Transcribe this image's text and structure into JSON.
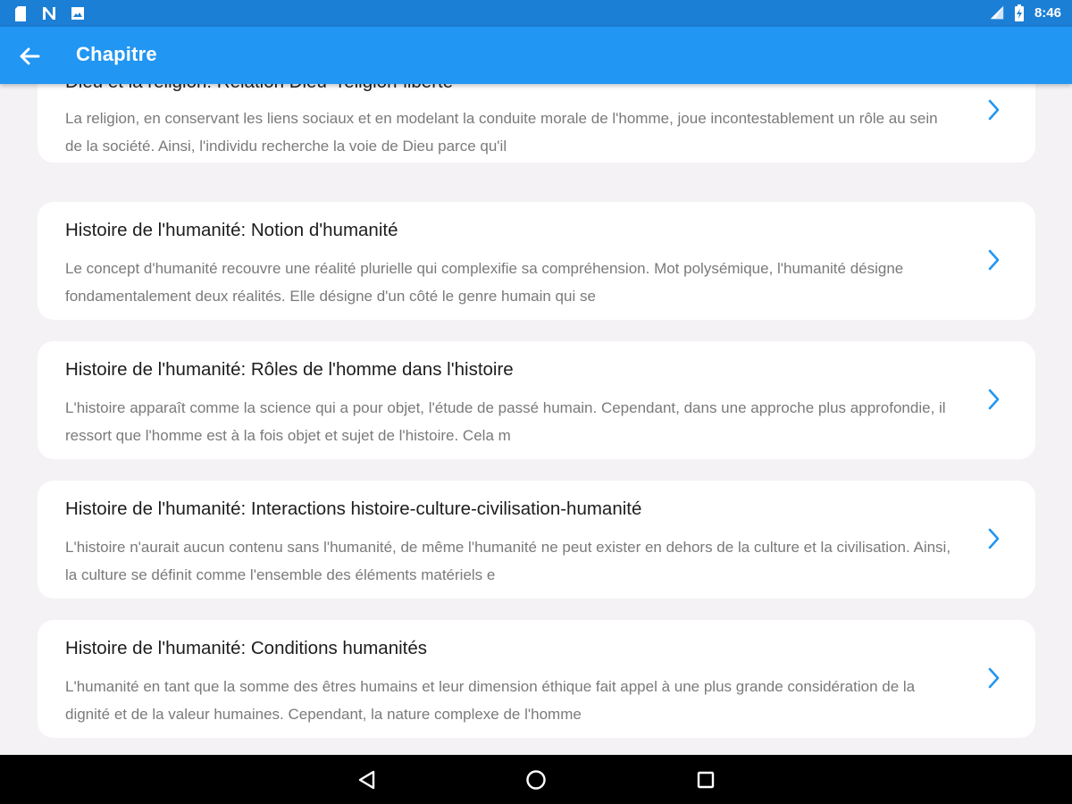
{
  "status_bar": {
    "time": "8:46",
    "left_icons": [
      "sd-card-icon",
      "n-notification-icon",
      "image-notification-icon"
    ],
    "right_icons": [
      "signal-icon",
      "battery-icon"
    ]
  },
  "app_bar": {
    "title": "Chapitre",
    "back_icon": "arrow-back-icon"
  },
  "chapters": [
    {
      "title": "Dieu et la religion: Relation Dieu- religion-liberté",
      "description": "La religion, en conservant les liens sociaux et en modelant la conduite morale de l'homme, joue incontestablement un rôle au sein de la société. Ainsi, l'individu recherche la voie de Dieu parce qu'il"
    },
    {
      "title": "Histoire de l'humanité: Notion d'humanité",
      "description": "Le concept d'humanité recouvre une réalité plurielle qui complexifie sa compréhension. Mot polysémique, l'humanité désigne fondamentalement deux réalités. Elle désigne d'un côté le genre humain qui se"
    },
    {
      "title": "Histoire de l'humanité: Rôles de l'homme dans l'histoire",
      "description": "L'histoire apparaît comme la science qui a pour objet, l'étude de passé humain. Cependant, dans une approche plus approfondie, il ressort que l'homme est à la fois objet et sujet de l'histoire. Cela m"
    },
    {
      "title": "Histoire de l'humanité: Interactions histoire-culture-civilisation-humanité",
      "description": "L'histoire n'aurait aucun contenu sans l'humanité, de même l'humanité ne peut exister en dehors de la culture et la civilisation. Ainsi, la culture se définit comme l'ensemble des éléments matériels e"
    },
    {
      "title": "Histoire de l'humanité: Conditions humanités",
      "description": "L'humanité en tant que la somme des êtres humains et leur dimension éthique fait appel à une plus grande considération de la dignité et de la valeur humaines. Cependant, la nature complexe de l'homme"
    }
  ],
  "nav_bar": {
    "icons": [
      "back-triangle-icon",
      "home-circle-icon",
      "recents-square-icon"
    ]
  },
  "colors": {
    "status_bar": "#1c7fd6",
    "app_bar": "#2196f3",
    "background": "#f4f2f5",
    "card": "#ffffff",
    "chevron": "#2196f3",
    "title_text": "#1d1d1d",
    "description_text": "#7a7a7a"
  }
}
